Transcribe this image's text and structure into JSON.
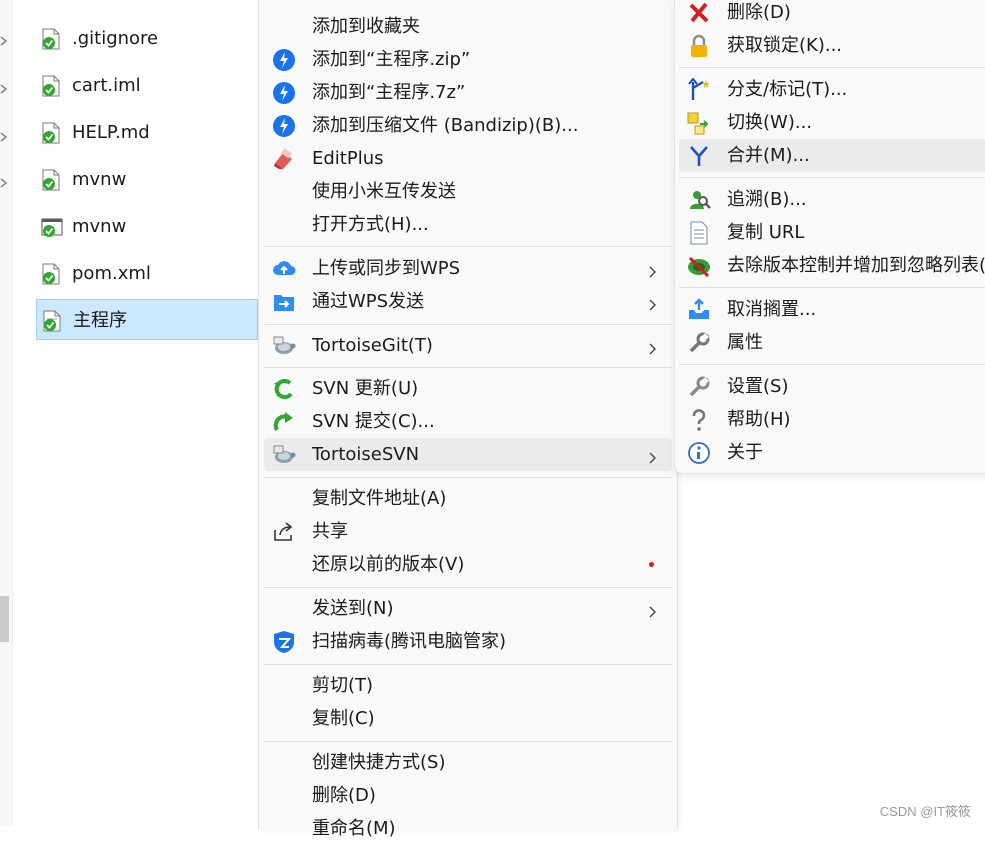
{
  "file_list": [
    {
      "name": ".gitignore",
      "icon": "file-svn-ok-icon",
      "selected": false
    },
    {
      "name": "cart.iml",
      "icon": "file-svn-ok-icon",
      "selected": false
    },
    {
      "name": "HELP.md",
      "icon": "file-svn-ok-icon",
      "selected": false
    },
    {
      "name": "mvnw",
      "icon": "file-svn-ok-icon",
      "selected": false
    },
    {
      "name": "mvnw",
      "icon": "script-svn-ok-icon",
      "selected": false
    },
    {
      "name": "pom.xml",
      "icon": "file-svn-ok-icon",
      "selected": false
    },
    {
      "name": "主程序",
      "icon": "file-svn-ok-icon",
      "selected": true
    }
  ],
  "context_menu": {
    "items": [
      {
        "label": "添加到收藏夹",
        "icon": null
      },
      {
        "label": "添加到“主程序.zip”",
        "icon": "bandizip-icon"
      },
      {
        "label": "添加到“主程序.7z”",
        "icon": "bandizip-icon"
      },
      {
        "label": "添加到压缩文件 (Bandizip)(B)...",
        "icon": "bandizip-icon"
      },
      {
        "label": "EditPlus",
        "icon": "editplus-icon"
      },
      {
        "label": "使用小米互传发送",
        "icon": null
      },
      {
        "label": "打开方式(H)...",
        "icon": null
      },
      {
        "label": "上传或同步到WPS",
        "icon": "wps-cloud-upload-icon",
        "submenu": true
      },
      {
        "label": "通过WPS发送",
        "icon": "wps-send-icon",
        "submenu": true
      },
      {
        "label": "TortoiseGit(T)",
        "icon": "tortoisegit-icon",
        "submenu": true
      },
      {
        "label": "SVN 更新(U)",
        "icon": "svn-update-icon"
      },
      {
        "label": "SVN 提交(C)...",
        "icon": "svn-commit-icon"
      },
      {
        "label": "TortoiseSVN",
        "icon": "tortoisesvn-icon",
        "submenu": true,
        "highlighted": true
      },
      {
        "label": "复制文件地址(A)",
        "icon": null
      },
      {
        "label": "共享",
        "icon": "share-icon"
      },
      {
        "label": "还原以前的版本(V)",
        "icon": null
      },
      {
        "label": "发送到(N)",
        "icon": null,
        "submenu": true
      },
      {
        "label": "扫描病毒(腾讯电脑管家)",
        "icon": "tencent-shield-icon"
      },
      {
        "label": "剪切(T)",
        "icon": null
      },
      {
        "label": "复制(C)",
        "icon": null
      },
      {
        "label": "创建快捷方式(S)",
        "icon": null
      },
      {
        "label": "删除(D)",
        "icon": null
      },
      {
        "label": "重命名(M)",
        "icon": null
      }
    ]
  },
  "tortoise_submenu": {
    "items": [
      {
        "label": "删除(D)",
        "icon": "delete-x-icon"
      },
      {
        "label": "获取锁定(K)...",
        "icon": "lock-icon"
      },
      {
        "label": "分支/标记(T)...",
        "icon": "branch-tag-icon"
      },
      {
        "label": "切换(W)...",
        "icon": "switch-icon"
      },
      {
        "label": "合并(M)...",
        "icon": "merge-icon",
        "highlighted": true
      },
      {
        "label": "追溯(B)...",
        "icon": "blame-icon"
      },
      {
        "label": "复制 URL",
        "icon": "copy-url-icon"
      },
      {
        "label": "去除版本控制并增加到忽略列表(I)",
        "icon": "ignore-icon"
      },
      {
        "label": "取消搁置...",
        "icon": "unshelve-icon"
      },
      {
        "label": "属性",
        "icon": "properties-wrench-icon"
      },
      {
        "label": "设置(S)",
        "icon": "settings-wrench-icon"
      },
      {
        "label": "帮助(H)",
        "icon": "help-icon"
      },
      {
        "label": "关于",
        "icon": "about-info-icon"
      }
    ]
  },
  "watermark": "CSDN @IT筱筱",
  "colors": {
    "selection_bg": "#cce8ff",
    "selection_border": "#99d1ff",
    "menu_bg": "#f9f9f9",
    "hover_bg": "#ebebeb",
    "svn_ok_green": "#2ea82e",
    "bandizip_blue": "#1a73e8",
    "wps_blue": "#2f8cf0"
  }
}
